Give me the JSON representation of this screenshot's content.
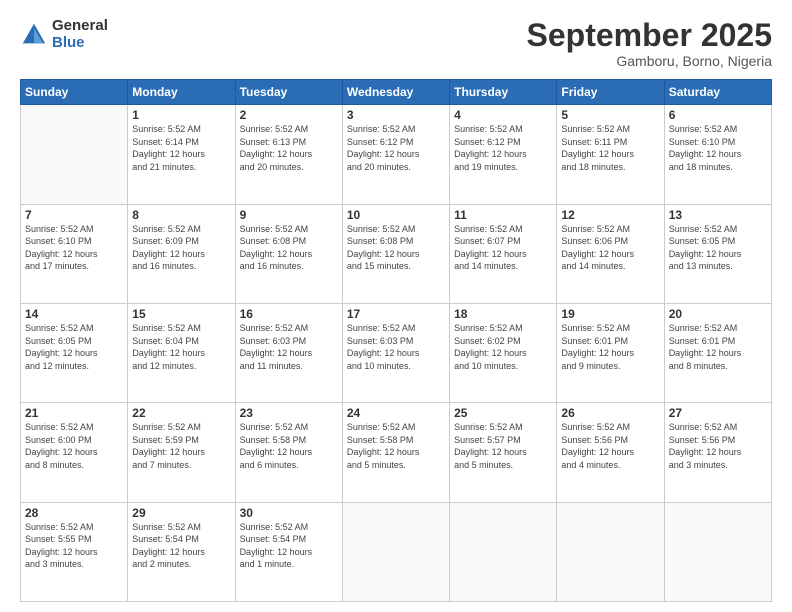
{
  "logo": {
    "general": "General",
    "blue": "Blue"
  },
  "header": {
    "month": "September 2025",
    "location": "Gamboru, Borno, Nigeria"
  },
  "weekdays": [
    "Sunday",
    "Monday",
    "Tuesday",
    "Wednesday",
    "Thursday",
    "Friday",
    "Saturday"
  ],
  "weeks": [
    [
      {
        "day": "",
        "info": ""
      },
      {
        "day": "1",
        "info": "Sunrise: 5:52 AM\nSunset: 6:14 PM\nDaylight: 12 hours\nand 21 minutes."
      },
      {
        "day": "2",
        "info": "Sunrise: 5:52 AM\nSunset: 6:13 PM\nDaylight: 12 hours\nand 20 minutes."
      },
      {
        "day": "3",
        "info": "Sunrise: 5:52 AM\nSunset: 6:12 PM\nDaylight: 12 hours\nand 20 minutes."
      },
      {
        "day": "4",
        "info": "Sunrise: 5:52 AM\nSunset: 6:12 PM\nDaylight: 12 hours\nand 19 minutes."
      },
      {
        "day": "5",
        "info": "Sunrise: 5:52 AM\nSunset: 6:11 PM\nDaylight: 12 hours\nand 18 minutes."
      },
      {
        "day": "6",
        "info": "Sunrise: 5:52 AM\nSunset: 6:10 PM\nDaylight: 12 hours\nand 18 minutes."
      }
    ],
    [
      {
        "day": "7",
        "info": "Sunrise: 5:52 AM\nSunset: 6:10 PM\nDaylight: 12 hours\nand 17 minutes."
      },
      {
        "day": "8",
        "info": "Sunrise: 5:52 AM\nSunset: 6:09 PM\nDaylight: 12 hours\nand 16 minutes."
      },
      {
        "day": "9",
        "info": "Sunrise: 5:52 AM\nSunset: 6:08 PM\nDaylight: 12 hours\nand 16 minutes."
      },
      {
        "day": "10",
        "info": "Sunrise: 5:52 AM\nSunset: 6:08 PM\nDaylight: 12 hours\nand 15 minutes."
      },
      {
        "day": "11",
        "info": "Sunrise: 5:52 AM\nSunset: 6:07 PM\nDaylight: 12 hours\nand 14 minutes."
      },
      {
        "day": "12",
        "info": "Sunrise: 5:52 AM\nSunset: 6:06 PM\nDaylight: 12 hours\nand 14 minutes."
      },
      {
        "day": "13",
        "info": "Sunrise: 5:52 AM\nSunset: 6:05 PM\nDaylight: 12 hours\nand 13 minutes."
      }
    ],
    [
      {
        "day": "14",
        "info": "Sunrise: 5:52 AM\nSunset: 6:05 PM\nDaylight: 12 hours\nand 12 minutes."
      },
      {
        "day": "15",
        "info": "Sunrise: 5:52 AM\nSunset: 6:04 PM\nDaylight: 12 hours\nand 12 minutes."
      },
      {
        "day": "16",
        "info": "Sunrise: 5:52 AM\nSunset: 6:03 PM\nDaylight: 12 hours\nand 11 minutes."
      },
      {
        "day": "17",
        "info": "Sunrise: 5:52 AM\nSunset: 6:03 PM\nDaylight: 12 hours\nand 10 minutes."
      },
      {
        "day": "18",
        "info": "Sunrise: 5:52 AM\nSunset: 6:02 PM\nDaylight: 12 hours\nand 10 minutes."
      },
      {
        "day": "19",
        "info": "Sunrise: 5:52 AM\nSunset: 6:01 PM\nDaylight: 12 hours\nand 9 minutes."
      },
      {
        "day": "20",
        "info": "Sunrise: 5:52 AM\nSunset: 6:01 PM\nDaylight: 12 hours\nand 8 minutes."
      }
    ],
    [
      {
        "day": "21",
        "info": "Sunrise: 5:52 AM\nSunset: 6:00 PM\nDaylight: 12 hours\nand 8 minutes."
      },
      {
        "day": "22",
        "info": "Sunrise: 5:52 AM\nSunset: 5:59 PM\nDaylight: 12 hours\nand 7 minutes."
      },
      {
        "day": "23",
        "info": "Sunrise: 5:52 AM\nSunset: 5:58 PM\nDaylight: 12 hours\nand 6 minutes."
      },
      {
        "day": "24",
        "info": "Sunrise: 5:52 AM\nSunset: 5:58 PM\nDaylight: 12 hours\nand 5 minutes."
      },
      {
        "day": "25",
        "info": "Sunrise: 5:52 AM\nSunset: 5:57 PM\nDaylight: 12 hours\nand 5 minutes."
      },
      {
        "day": "26",
        "info": "Sunrise: 5:52 AM\nSunset: 5:56 PM\nDaylight: 12 hours\nand 4 minutes."
      },
      {
        "day": "27",
        "info": "Sunrise: 5:52 AM\nSunset: 5:56 PM\nDaylight: 12 hours\nand 3 minutes."
      }
    ],
    [
      {
        "day": "28",
        "info": "Sunrise: 5:52 AM\nSunset: 5:55 PM\nDaylight: 12 hours\nand 3 minutes."
      },
      {
        "day": "29",
        "info": "Sunrise: 5:52 AM\nSunset: 5:54 PM\nDaylight: 12 hours\nand 2 minutes."
      },
      {
        "day": "30",
        "info": "Sunrise: 5:52 AM\nSunset: 5:54 PM\nDaylight: 12 hours\nand 1 minute."
      },
      {
        "day": "",
        "info": ""
      },
      {
        "day": "",
        "info": ""
      },
      {
        "day": "",
        "info": ""
      },
      {
        "day": "",
        "info": ""
      }
    ]
  ]
}
